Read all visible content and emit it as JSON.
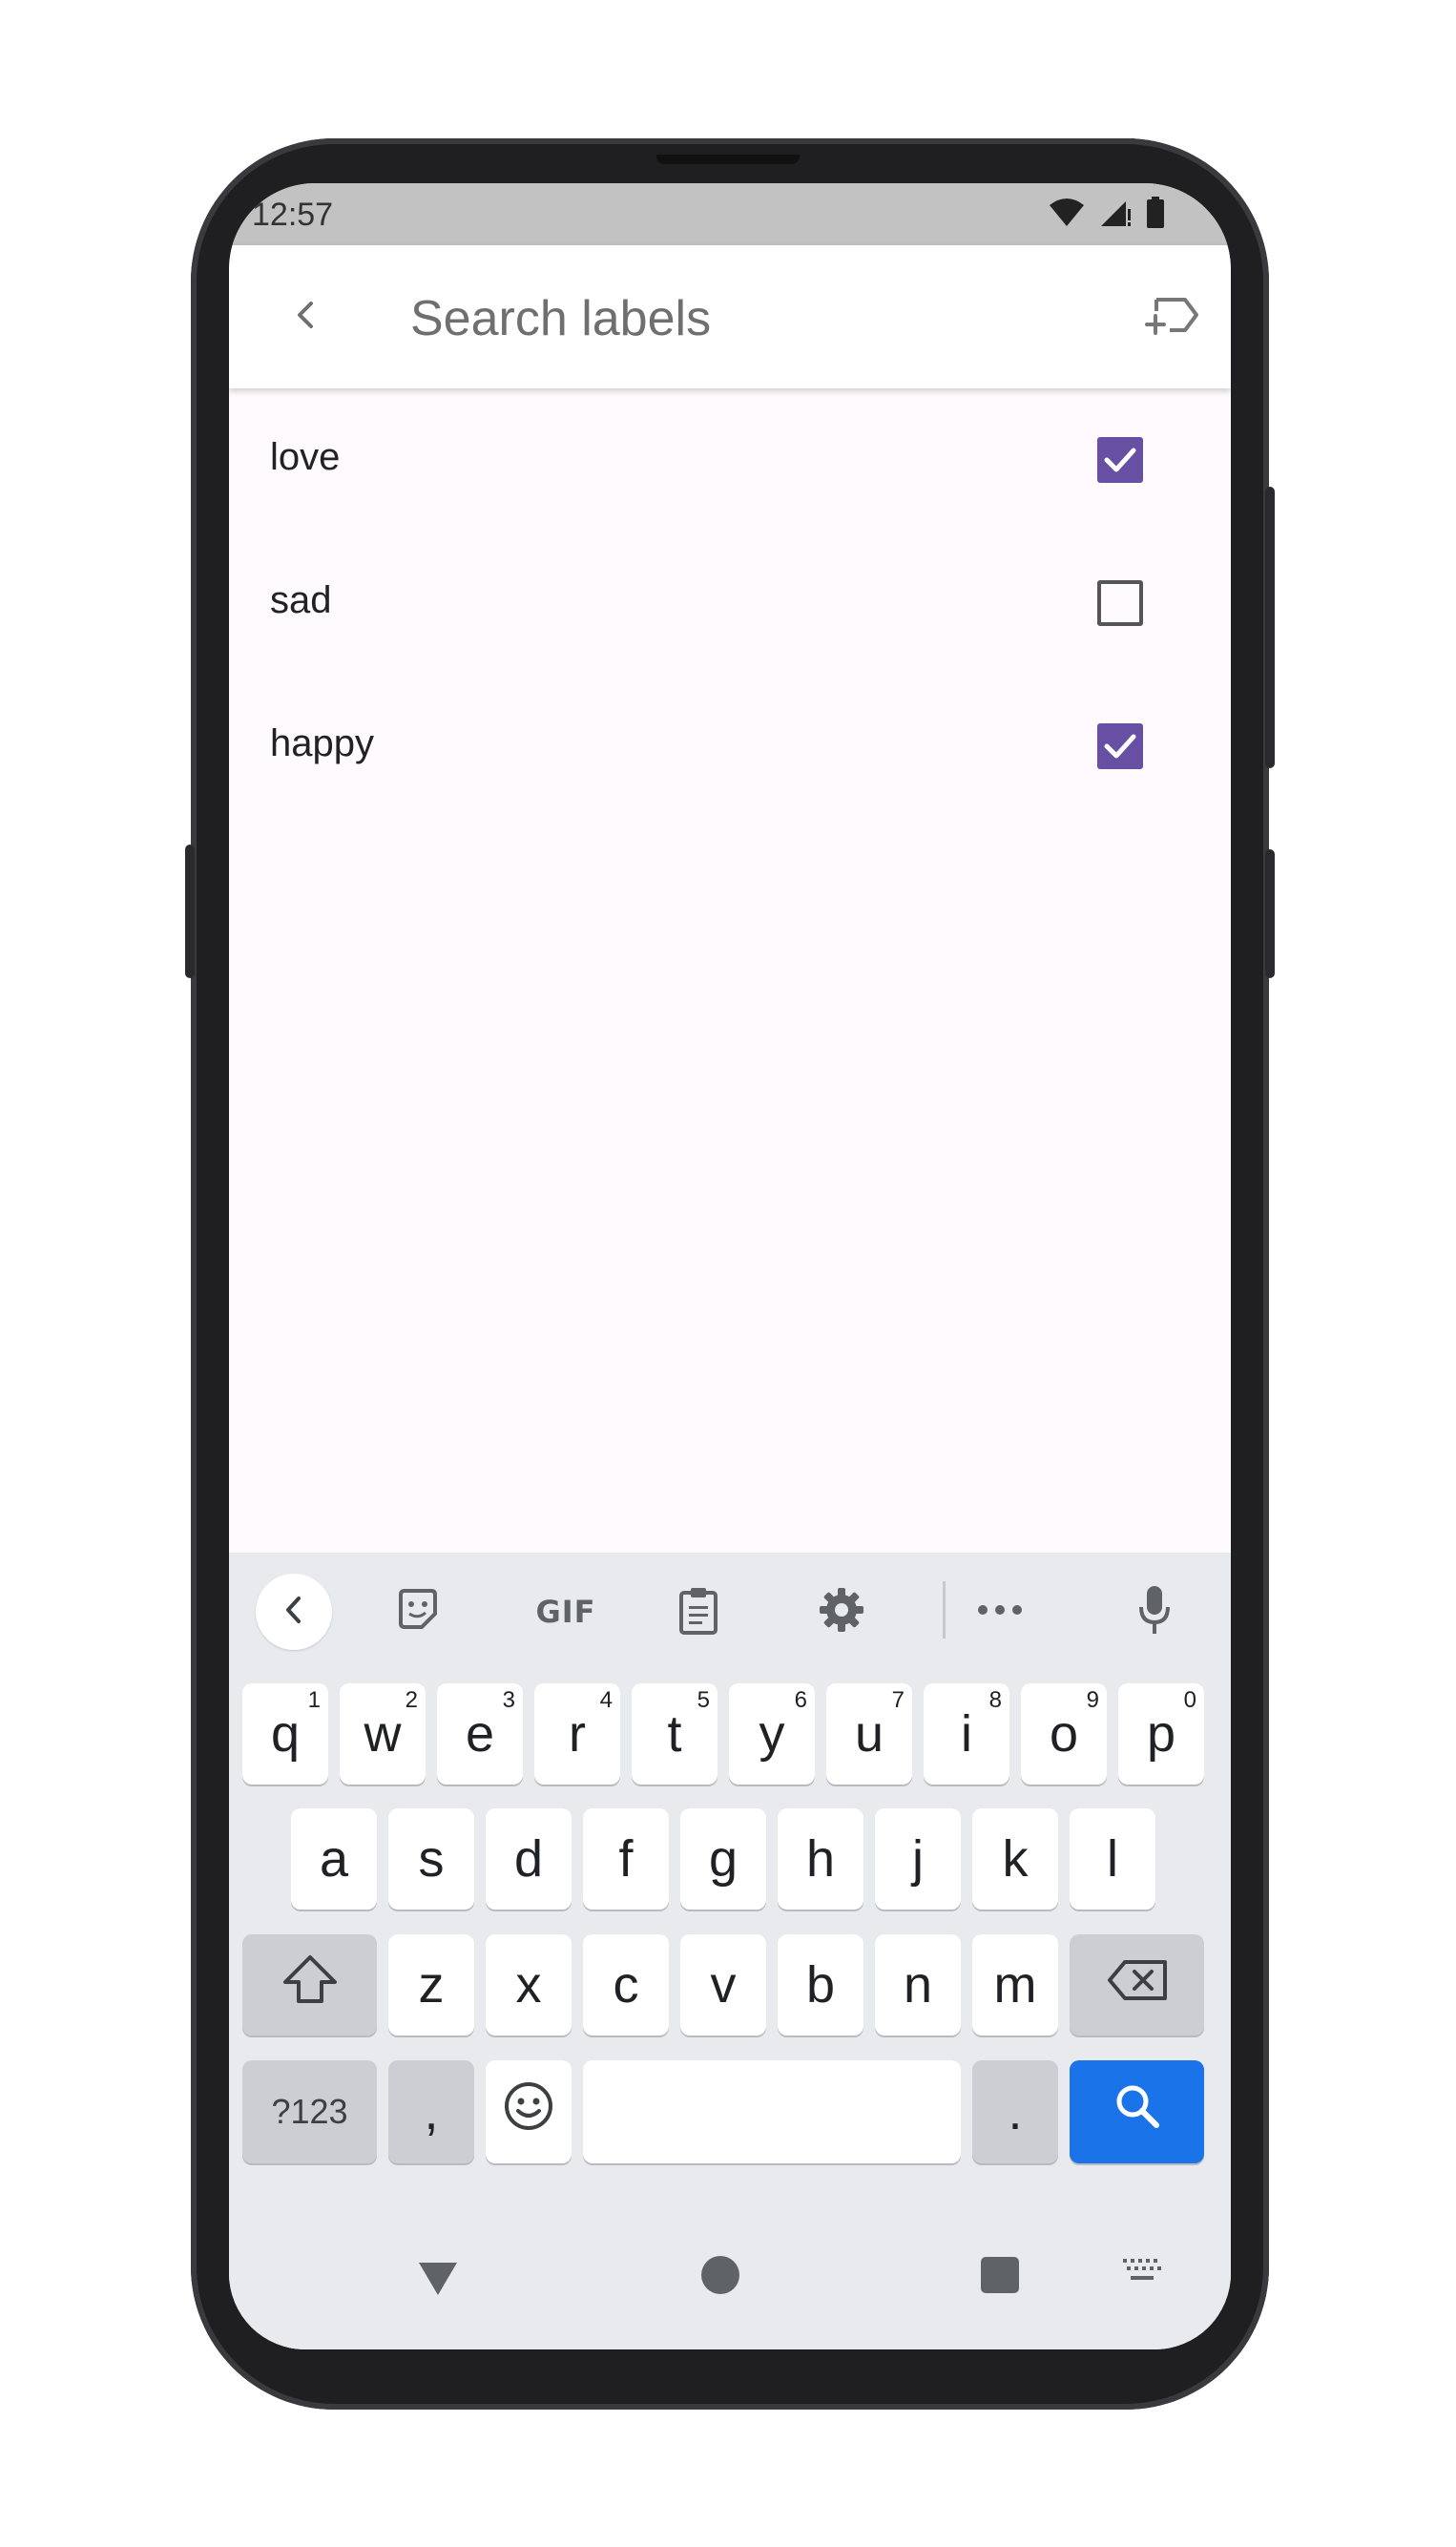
{
  "status_bar": {
    "time": "12:57",
    "icons": [
      "wifi-icon",
      "signal-icon",
      "battery-icon"
    ]
  },
  "app_bar": {
    "title": "Search labels",
    "back_icon": "chevron-left-icon",
    "action_icon": "new-label-icon"
  },
  "labels": [
    {
      "name": "love",
      "checked": true
    },
    {
      "name": "sad",
      "checked": false
    },
    {
      "name": "happy",
      "checked": true
    }
  ],
  "keyboard": {
    "toolbar": {
      "gif_label": "GIF",
      "icons": [
        "collapse-icon",
        "sticker-icon",
        "clipboard-icon",
        "settings-icon",
        "more-icon",
        "microphone-icon"
      ]
    },
    "row1": [
      {
        "key": "q",
        "hint": "1"
      },
      {
        "key": "w",
        "hint": "2"
      },
      {
        "key": "e",
        "hint": "3"
      },
      {
        "key": "r",
        "hint": "4"
      },
      {
        "key": "t",
        "hint": "5"
      },
      {
        "key": "y",
        "hint": "6"
      },
      {
        "key": "u",
        "hint": "7"
      },
      {
        "key": "i",
        "hint": "8"
      },
      {
        "key": "o",
        "hint": "9"
      },
      {
        "key": "p",
        "hint": "0"
      }
    ],
    "row2": [
      "a",
      "s",
      "d",
      "f",
      "g",
      "h",
      "j",
      "k",
      "l"
    ],
    "row3": [
      "z",
      "x",
      "c",
      "v",
      "b",
      "n",
      "m"
    ],
    "symbols_label": "?123",
    "comma_label": ",",
    "period_label": "."
  },
  "colors": {
    "accent": "#6750a4",
    "search_key": "#1a73e8",
    "status_bar": "#c2c2c2"
  }
}
